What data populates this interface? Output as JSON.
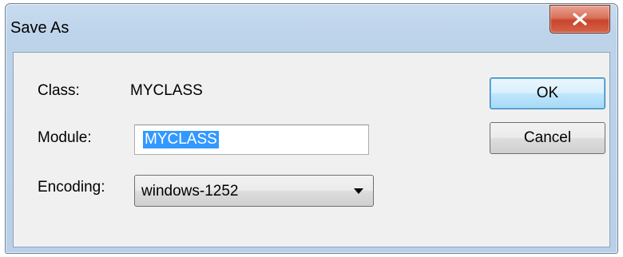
{
  "window": {
    "title": "Save As"
  },
  "form": {
    "class_label": "Class:",
    "class_value": "MYCLASS",
    "module_label": "Module:",
    "module_value": "MYCLASS",
    "encoding_label": "Encoding:",
    "encoding_value": "windows-1252"
  },
  "buttons": {
    "ok": "OK",
    "cancel": "Cancel"
  },
  "icons": {
    "close": "close-icon",
    "dropdown": "chevron-down-icon"
  },
  "colors": {
    "selection": "#3399ff",
    "close_button": "#c8452b",
    "default_button_border": "#3c7fb1"
  }
}
